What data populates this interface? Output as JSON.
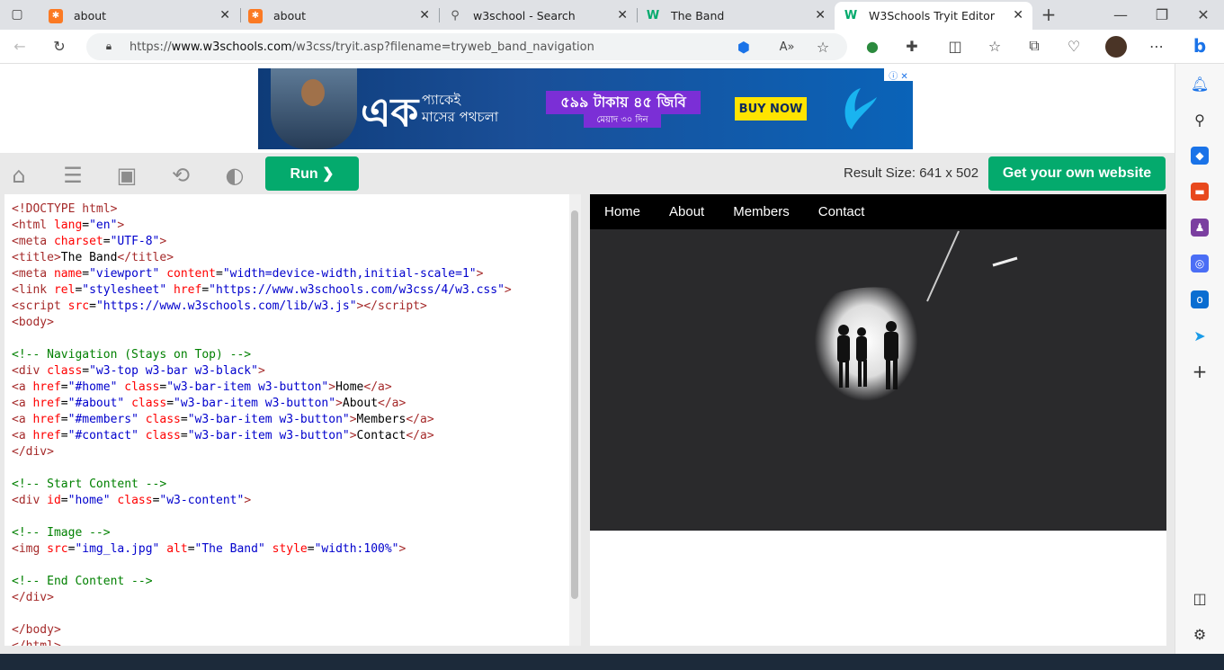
{
  "tabs": [
    {
      "title": "about",
      "favicon": "xampp-icon"
    },
    {
      "title": "about",
      "favicon": "xampp-icon"
    },
    {
      "title": "w3school - Search",
      "favicon": "search-icon"
    },
    {
      "title": "The Band",
      "favicon": "w3schools-icon"
    },
    {
      "title": "W3Schools Tryit Editor",
      "favicon": "w3schools-icon",
      "active": true
    }
  ],
  "address": {
    "prefix": "https://",
    "domain": "www.w3schools.com",
    "path": "/w3css/tryit.asp?filename=tryweb_band_navigation"
  },
  "ad": {
    "headline": "এক",
    "sub1": "প্যাকেই",
    "sub2": "মাসের পথচলা",
    "offer": "৫৯৯ টাকায় ৪৫ জিবি",
    "validity": "মেয়াদ ৩০ দিন",
    "cta": "BUY NOW"
  },
  "toolbar": {
    "run_label": "Run ❯",
    "result_size": "Result Size: 641 x 502",
    "get_website": "Get your own website"
  },
  "result": {
    "nav": [
      "Home",
      "About",
      "Members",
      "Contact"
    ]
  },
  "colors": {
    "w3_green": "#04aa6d",
    "nav_black": "#000000"
  }
}
